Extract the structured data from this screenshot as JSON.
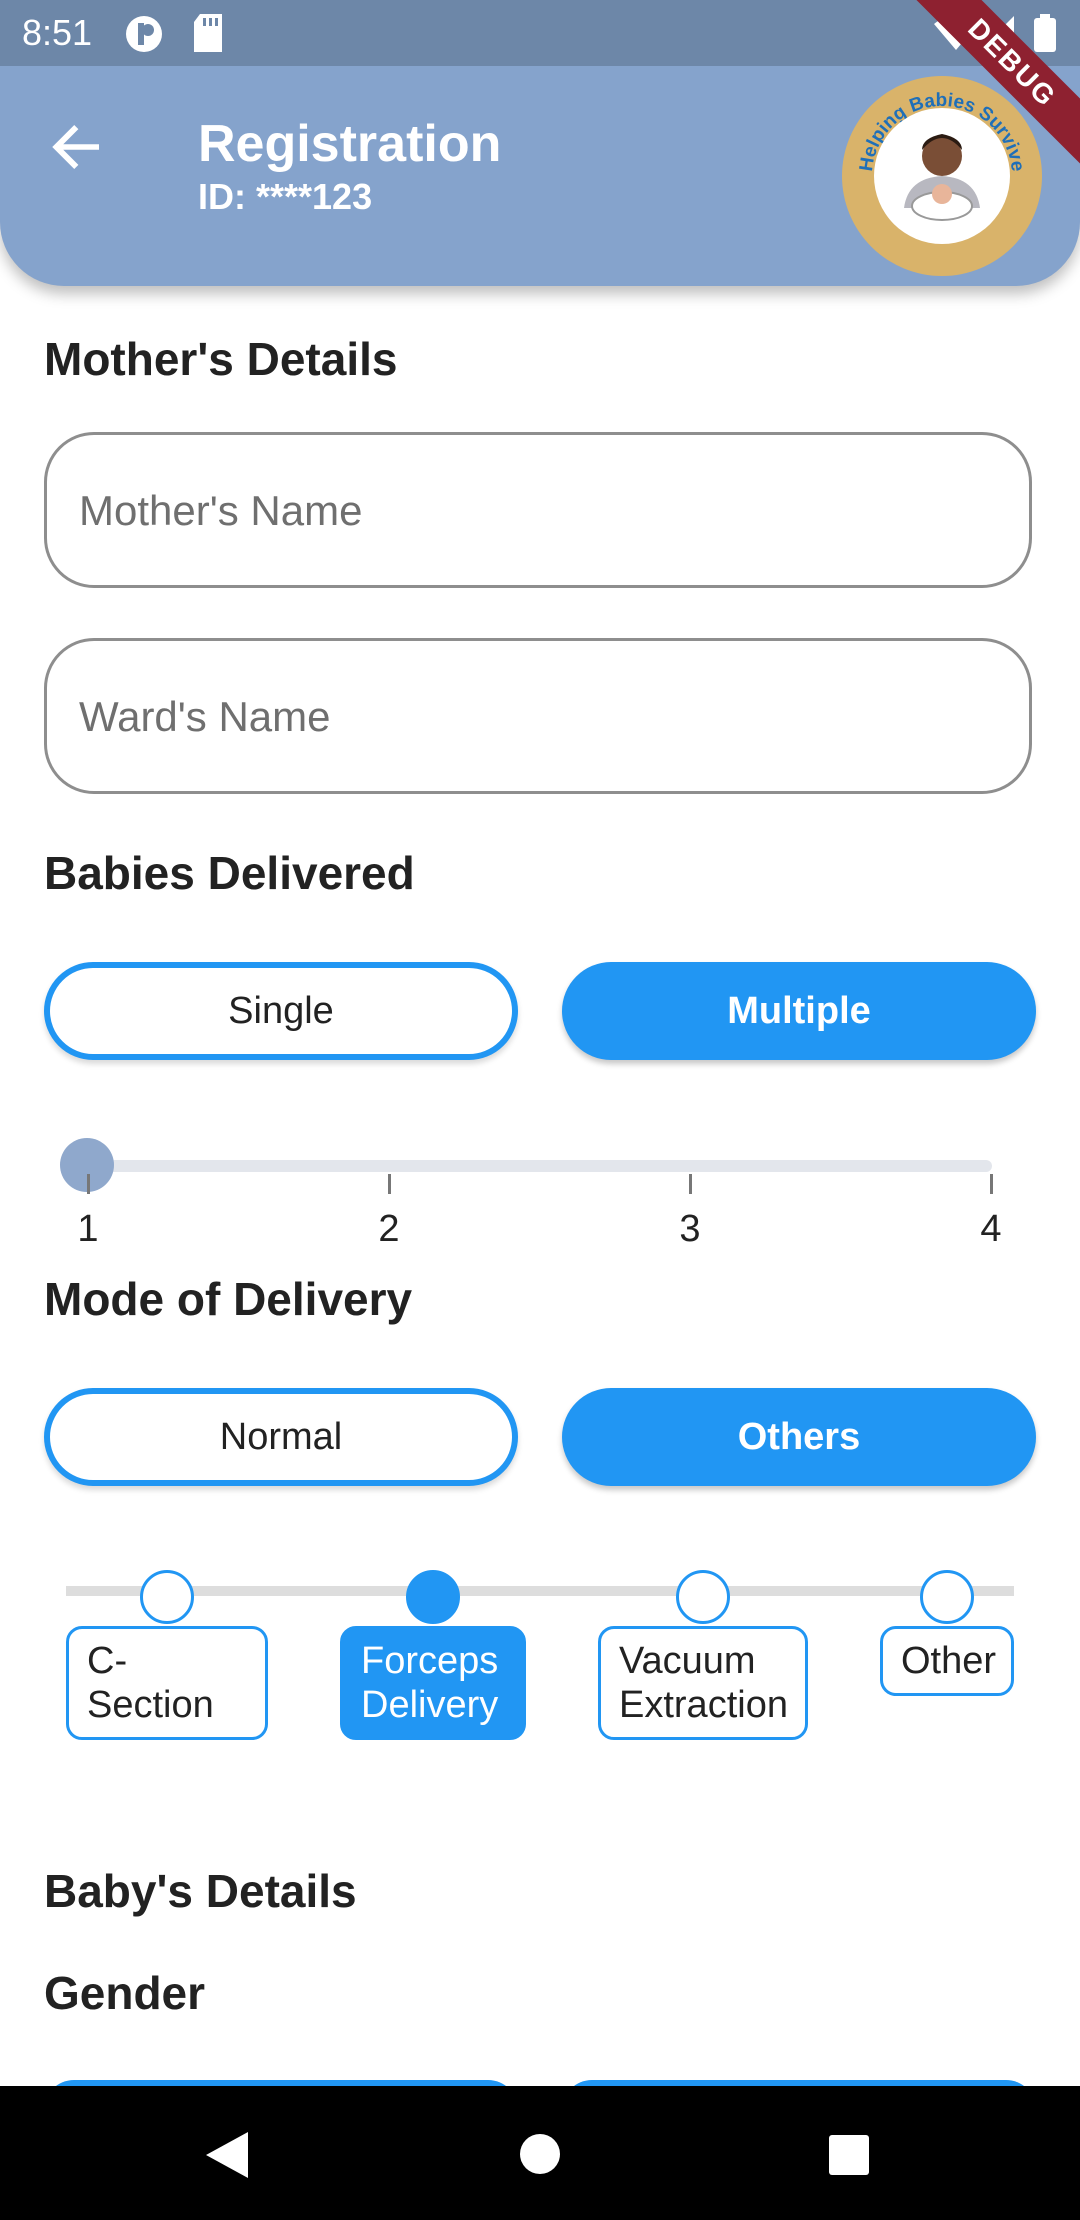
{
  "status_bar": {
    "time": "8:51",
    "icons": [
      "notification-p-icon",
      "sd-card-icon",
      "wifi-icon",
      "signal-icon",
      "battery-icon"
    ]
  },
  "app_bar": {
    "title": "Registration",
    "subtitle": "ID: ****123",
    "logo_text": "Helping Babies Survive",
    "debug_label": "DEBUG"
  },
  "mothers_details": {
    "heading": "Mother's Details",
    "mother_name_placeholder": "Mother's Name",
    "ward_name_placeholder": "Ward's Name"
  },
  "babies_delivered": {
    "heading": "Babies Delivered",
    "options": [
      "Single",
      "Multiple"
    ],
    "selected": "Multiple",
    "slider": {
      "min": 1,
      "max": 4,
      "value": 1,
      "labels": [
        "1",
        "2",
        "3",
        "4"
      ]
    }
  },
  "mode_of_delivery": {
    "heading": "Mode of Delivery",
    "options": [
      "Normal",
      "Others"
    ],
    "selected": "Others",
    "other_modes": [
      {
        "label": "C-Section"
      },
      {
        "label": "Forceps Delivery"
      },
      {
        "label": "Vacuum Extraction"
      },
      {
        "label": "Other"
      }
    ],
    "selected_other_mode": "Forceps Delivery"
  },
  "babys_details": {
    "heading": "Baby's Details",
    "gender_heading": "Gender"
  },
  "colors": {
    "primary": "#2196f3",
    "app_bar": "#85a3cc",
    "status_bar": "#6d87a8",
    "debug": "#8e2130"
  }
}
